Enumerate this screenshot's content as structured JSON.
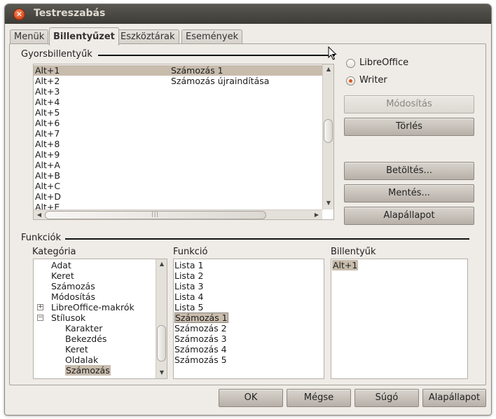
{
  "window": {
    "title": "Testreszabás"
  },
  "tabs": [
    {
      "label": "Menük"
    },
    {
      "label": "Billentyűzet"
    },
    {
      "label": "Eszköztárak"
    },
    {
      "label": "Események"
    }
  ],
  "shortcuts": {
    "section_label": "Gyorsbillentyűk",
    "rows": [
      {
        "key": "Alt+1",
        "command": "Számozás 1"
      },
      {
        "key": "Alt+2",
        "command": "Számozás újraindítása"
      },
      {
        "key": "Alt+3",
        "command": ""
      },
      {
        "key": "Alt+4",
        "command": ""
      },
      {
        "key": "Alt+5",
        "command": ""
      },
      {
        "key": "Alt+6",
        "command": ""
      },
      {
        "key": "Alt+7",
        "command": ""
      },
      {
        "key": "Alt+8",
        "command": ""
      },
      {
        "key": "Alt+9",
        "command": ""
      },
      {
        "key": "Alt+A",
        "command": ""
      },
      {
        "key": "Alt+B",
        "command": ""
      },
      {
        "key": "Alt+C",
        "command": ""
      },
      {
        "key": "Alt+D",
        "command": ""
      },
      {
        "key": "Alt+E",
        "command": ""
      }
    ]
  },
  "scope": {
    "options": [
      {
        "label": "LibreOffice",
        "checked": false
      },
      {
        "label": "Writer",
        "checked": true
      }
    ]
  },
  "side_buttons": {
    "modify": "Módosítás",
    "delete": "Törlés",
    "load": "Betöltés...",
    "save": "Mentés...",
    "reset": "Alapállapot"
  },
  "functions": {
    "section_label": "Funkciók",
    "category_label": "Kategória",
    "function_label": "Funkció",
    "keys_label": "Billentyűk",
    "categories": [
      {
        "label": "Adat",
        "indent": 1,
        "expander": ""
      },
      {
        "label": "Keret",
        "indent": 1,
        "expander": ""
      },
      {
        "label": "Számozás",
        "indent": 1,
        "expander": ""
      },
      {
        "label": "Módosítás",
        "indent": 1,
        "expander": ""
      },
      {
        "label": "LibreOffice-makrók",
        "indent": 1,
        "expander": "+"
      },
      {
        "label": "Stílusok",
        "indent": 1,
        "expander": "−"
      },
      {
        "label": "Karakter",
        "indent": 2,
        "expander": ""
      },
      {
        "label": "Bekezdés",
        "indent": 2,
        "expander": ""
      },
      {
        "label": "Keret",
        "indent": 2,
        "expander": ""
      },
      {
        "label": "Oldalak",
        "indent": 2,
        "expander": ""
      },
      {
        "label": "Számozás",
        "indent": 2,
        "expander": "",
        "selected": true
      }
    ],
    "functions": [
      {
        "label": "Lista 1"
      },
      {
        "label": "Lista 2"
      },
      {
        "label": "Lista 3"
      },
      {
        "label": "Lista 4"
      },
      {
        "label": "Lista 5"
      },
      {
        "label": "Számozás 1",
        "selected": true
      },
      {
        "label": "Számozás 2"
      },
      {
        "label": "Számozás 3"
      },
      {
        "label": "Számozás 4"
      },
      {
        "label": "Számozás 5"
      }
    ],
    "keys": [
      {
        "label": "Alt+1",
        "selected": true
      }
    ]
  },
  "footer": {
    "ok": "OK",
    "cancel": "Mégse",
    "help": "Súgó",
    "reset": "Alapállapot"
  },
  "colors": {
    "selection": "#c8bcad",
    "radio_dot": "#e0571f",
    "titlebar": "#3d3b37"
  },
  "icons": {
    "close": "close-icon",
    "cursor": "mouse-pointer-icon"
  }
}
